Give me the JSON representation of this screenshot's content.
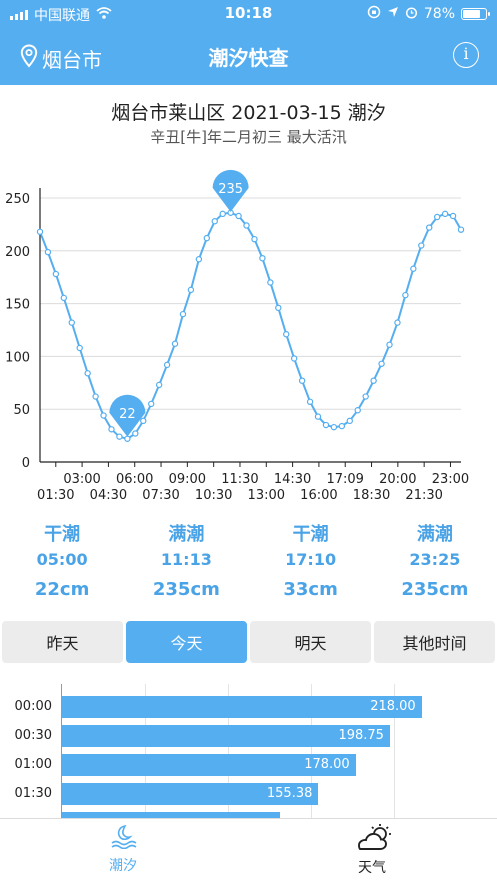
{
  "status_bar": {
    "carrier": "中国联通",
    "time": "10:18",
    "battery": "78%",
    "battery_level": 0.78
  },
  "nav": {
    "city": "烟台市",
    "title": "潮汐快查",
    "info_symbol": "i"
  },
  "header": {
    "title": "烟台市莱山区 2021-03-15 潮汐",
    "subtitle": "辛丑[牛]年二月初三 最大活汛"
  },
  "chart_data": {
    "type": "line",
    "title": "",
    "xlabel": "",
    "ylabel": "",
    "ylim": [
      0,
      250
    ],
    "y_ticks": [
      "0",
      "50",
      "100",
      "150",
      "200",
      "250"
    ],
    "x_ticks_row1": [
      "03:00",
      "06:00",
      "09:00",
      "11:30",
      "14:30",
      "17:09",
      "20:00",
      "23:00"
    ],
    "x_ticks_row2": [
      "01:30",
      "04:30",
      "07:30",
      "10:30",
      "13:00",
      "16:00",
      "18:30",
      "21:30"
    ],
    "grid": true,
    "series": [
      {
        "x_minutes_step": 30,
        "values": [
          218,
          198.75,
          178,
          155.38,
          132,
          108,
          84,
          62,
          44,
          31,
          24,
          22,
          27,
          39,
          55,
          73,
          92,
          112,
          140,
          163,
          192,
          212,
          228,
          235,
          236,
          233,
          224,
          211,
          193,
          170,
          146,
          121,
          98,
          77,
          57,
          43,
          35,
          33,
          34,
          39,
          49,
          62,
          77,
          93,
          111,
          132,
          158,
          183,
          205,
          222,
          232,
          235,
          233,
          220
        ]
      }
    ],
    "annotations": [
      {
        "label": "235",
        "x_index": 24,
        "y": 235
      },
      {
        "label": "22",
        "x_index": 11,
        "y": 22
      }
    ]
  },
  "summary": [
    {
      "type": "干潮",
      "time": "05:00",
      "height": "22cm"
    },
    {
      "type": "满潮",
      "time": "11:13",
      "height": "235cm"
    },
    {
      "type": "干潮",
      "time": "17:10",
      "height": "33cm"
    },
    {
      "type": "满潮",
      "time": "23:25",
      "height": "235cm"
    }
  ],
  "tabs": [
    "昨天",
    "今天",
    "明天",
    "其他时间"
  ],
  "table": {
    "max": 240,
    "rows": [
      {
        "time": "00:00",
        "value": 218.0,
        "label": "218.00"
      },
      {
        "time": "00:30",
        "value": 198.75,
        "label": "198.75"
      },
      {
        "time": "01:00",
        "value": 178.0,
        "label": "178.00"
      },
      {
        "time": "01:30",
        "value": 155.38,
        "label": "155.38"
      },
      {
        "time": "",
        "value": 132.0,
        "label": ""
      }
    ]
  },
  "tabbar": {
    "tide_label": "潮汐",
    "weather_label": "天气",
    "accent": "#55aef0"
  }
}
